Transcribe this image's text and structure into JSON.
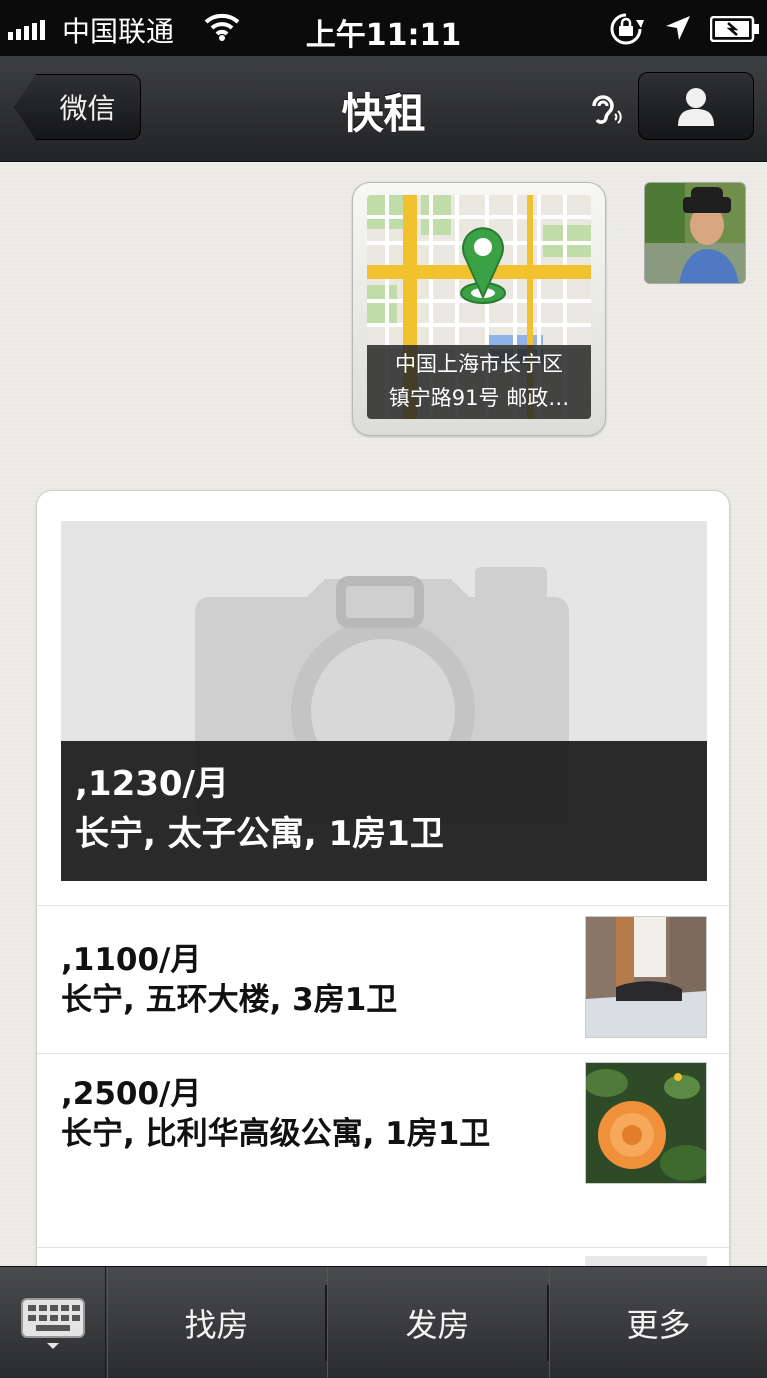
{
  "status_bar": {
    "carrier": "中国联通",
    "time": "上午11:11",
    "icons": [
      "signal-icon",
      "wifi-icon",
      "rotation-lock-icon",
      "location-arrow-icon",
      "battery-icon"
    ]
  },
  "nav": {
    "back_label": "微信",
    "title": "快租",
    "icons": [
      "ear-icon",
      "profile-icon"
    ]
  },
  "chat": {
    "location_message": {
      "caption_line1": "中国上海市长宁区",
      "caption_line2": "镇宁路91号 邮政…"
    },
    "listing_card": {
      "featured": {
        "price": ",1230/月",
        "description": "长宁, 太子公寓, 1房1卫"
      },
      "items": [
        {
          "price": ",1100/月",
          "description": "长宁, 五环大楼, 3房1卫"
        },
        {
          "price": ",2500/月",
          "description": "长宁, 比利华高级公寓, 1房1卫"
        }
      ]
    }
  },
  "bottom_bar": {
    "keyboard_icon": "keyboard-icon",
    "menu": [
      "找房",
      "发房",
      "更多"
    ]
  },
  "colors": {
    "nav_bg": "#2a2b2d",
    "chat_bg": "#edece7",
    "map_road": "#f2c12e",
    "map_pin": "#3aa245"
  }
}
